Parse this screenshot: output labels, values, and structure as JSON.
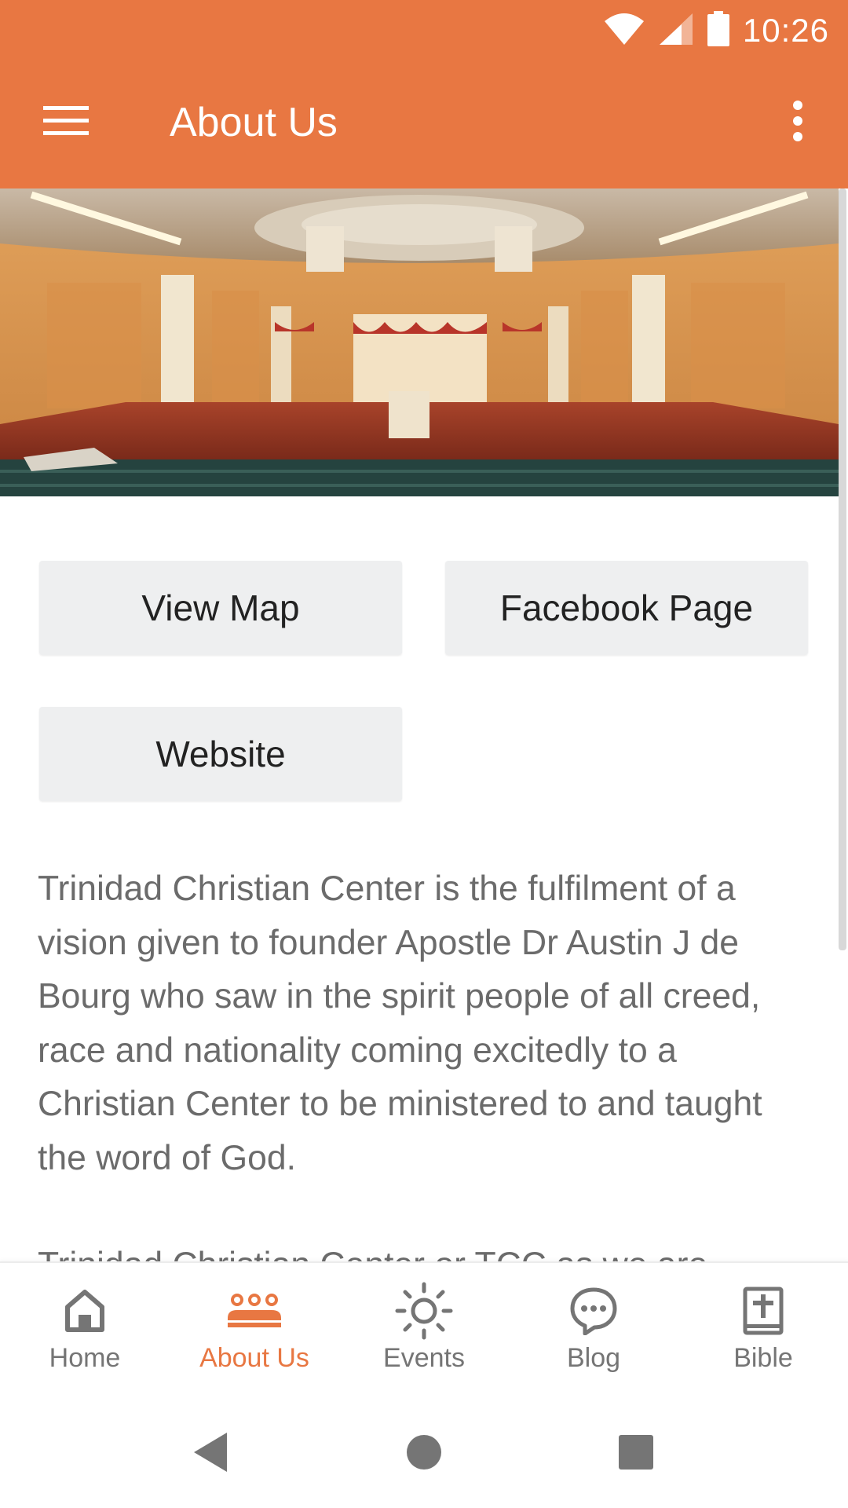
{
  "status_bar": {
    "time": "10:26",
    "icons": [
      "wifi-icon",
      "signal-icon",
      "battery-icon"
    ]
  },
  "app_bar": {
    "title": "About Us",
    "menu_icon": "hamburger-menu-icon",
    "more_icon": "more-vertical-icon"
  },
  "hero": {
    "image": "church-sanctuary-interior-photo"
  },
  "buttons": {
    "view_map": "View Map",
    "facebook_page": "Facebook Page",
    "website": "Website"
  },
  "description": {
    "paragraph1": "Trinidad Christian Center is the fulfilment of a vision given to founder Apostle Dr Austin J de Bourg who saw in the spirit people of all creed, race and nationality coming excitedly to a Christian Center to be ministered to and taught the word of God.",
    "paragraph2": "Trinidad Christian Center or TCC as we are"
  },
  "bottom_nav": {
    "items": [
      {
        "label": "Home",
        "icon": "home-icon",
        "active": false
      },
      {
        "label": "About Us",
        "icon": "people-group-icon",
        "active": true
      },
      {
        "label": "Events",
        "icon": "sun-icon",
        "active": false
      },
      {
        "label": "Blog",
        "icon": "chat-bubble-icon",
        "active": false
      },
      {
        "label": "Bible",
        "icon": "bible-book-icon",
        "active": false
      }
    ]
  },
  "colors": {
    "primary": "#E87742",
    "button_bg": "#EEEFF0",
    "text_muted": "#6B6B6B",
    "nav_inactive": "#757575"
  }
}
